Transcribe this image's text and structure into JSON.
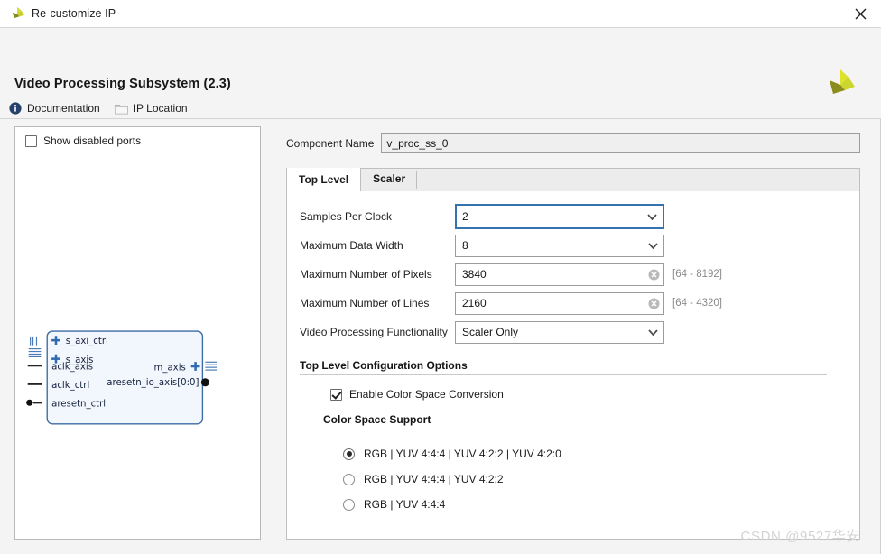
{
  "window": {
    "title": "Re-customize IP",
    "close_label": "✕"
  },
  "header": {
    "ip_title": "Video Processing Subsystem (2.3)",
    "links": [
      {
        "label": "Documentation",
        "icon": "info-icon"
      },
      {
        "label": "IP Location",
        "icon": "folder-icon"
      }
    ],
    "brand_icon": "xilinx-logo-icon"
  },
  "left_panel": {
    "show_disabled_ports": {
      "label": "Show disabled ports",
      "checked": false
    },
    "ip_block": {
      "left_ports": [
        {
          "name": "s_axi_ctrl",
          "type": "bus"
        },
        {
          "name": "s_axis",
          "type": "bus"
        },
        {
          "name": "aclk_axis",
          "type": "clock"
        },
        {
          "name": "aclk_ctrl",
          "type": "clock"
        },
        {
          "name": "aresetn_ctrl",
          "type": "reset"
        }
      ],
      "right_ports": [
        {
          "name": "m_axis",
          "type": "bus"
        },
        {
          "name": "aresetn_io_axis[0:0]",
          "type": "signal"
        }
      ]
    }
  },
  "form": {
    "component_name": {
      "label": "Component Name",
      "value": "v_proc_ss_0"
    },
    "tabs": [
      {
        "label": "Top Level",
        "active": true
      },
      {
        "label": "Scaler",
        "active": false
      }
    ],
    "fields": [
      {
        "label": "Samples Per Clock",
        "kind": "combo",
        "value": "2",
        "focused": true,
        "name": "samples-per-clock"
      },
      {
        "label": "Maximum Data Width",
        "kind": "combo",
        "value": "8",
        "focused": false,
        "name": "maximum-data-width"
      },
      {
        "label": "Maximum Number of Pixels",
        "kind": "text",
        "value": "3840",
        "hint": "[64 - 8192]",
        "name": "maximum-number-of-pixels"
      },
      {
        "label": "Maximum Number of Lines",
        "kind": "text",
        "value": "2160",
        "hint": "[64 - 4320]",
        "name": "maximum-number-of-lines"
      },
      {
        "label": "Video Processing Functionality",
        "kind": "combo",
        "value": "Scaler Only",
        "focused": false,
        "name": "video-processing-functionality"
      }
    ],
    "top_level_section": {
      "heading": "Top Level Configuration Options",
      "checkbox": {
        "label": "Enable Color Space Conversion",
        "checked": true
      }
    },
    "color_space_section": {
      "heading": "Color Space Support",
      "options": [
        {
          "label": "RGB | YUV 4:4:4 | YUV 4:2:2 | YUV 4:2:0",
          "selected": true
        },
        {
          "label": "RGB | YUV 4:4:4 | YUV 4:2:2",
          "selected": false
        },
        {
          "label": "RGB | YUV 4:4:4",
          "selected": false
        }
      ]
    }
  },
  "watermark": "CSDN @9527华安",
  "colors": {
    "accent_focus": "#3572b0",
    "header_bg": "#f4f4f4",
    "brand_yellow": "#d6dc2a",
    "brand_olive": "#87881c",
    "link_icon_blue": "#26416b"
  }
}
